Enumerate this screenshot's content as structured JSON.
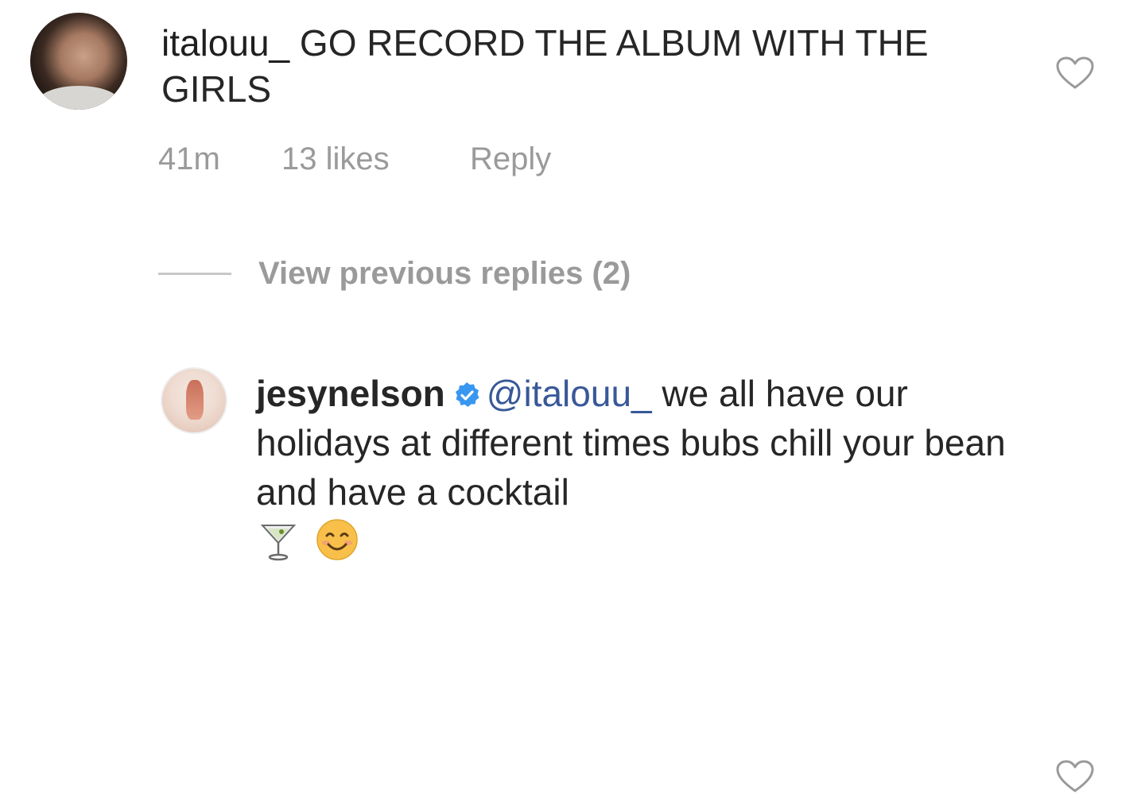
{
  "comments": [
    {
      "username": "italouu_",
      "text": "GO RECORD THE ALBUM WITH THE GIRLS",
      "time": "41m",
      "likes": "13 likes",
      "reply_label": "Reply"
    }
  ],
  "view_previous": {
    "label": "View previous replies (2)"
  },
  "reply": {
    "username": "jesynelson",
    "verified": true,
    "mention": "@italouu_",
    "text": "we all have our holidays at different times bubs chill your bean and have a cocktail",
    "emojis": [
      "cocktail-glass",
      "smiling-face"
    ]
  },
  "colors": {
    "mention": "#385898",
    "meta_text": "#9a9a9a",
    "verified_badge": "#3897f0"
  },
  "icons": {
    "like": "heart-outline-icon",
    "verified": "verified-badge-icon"
  }
}
